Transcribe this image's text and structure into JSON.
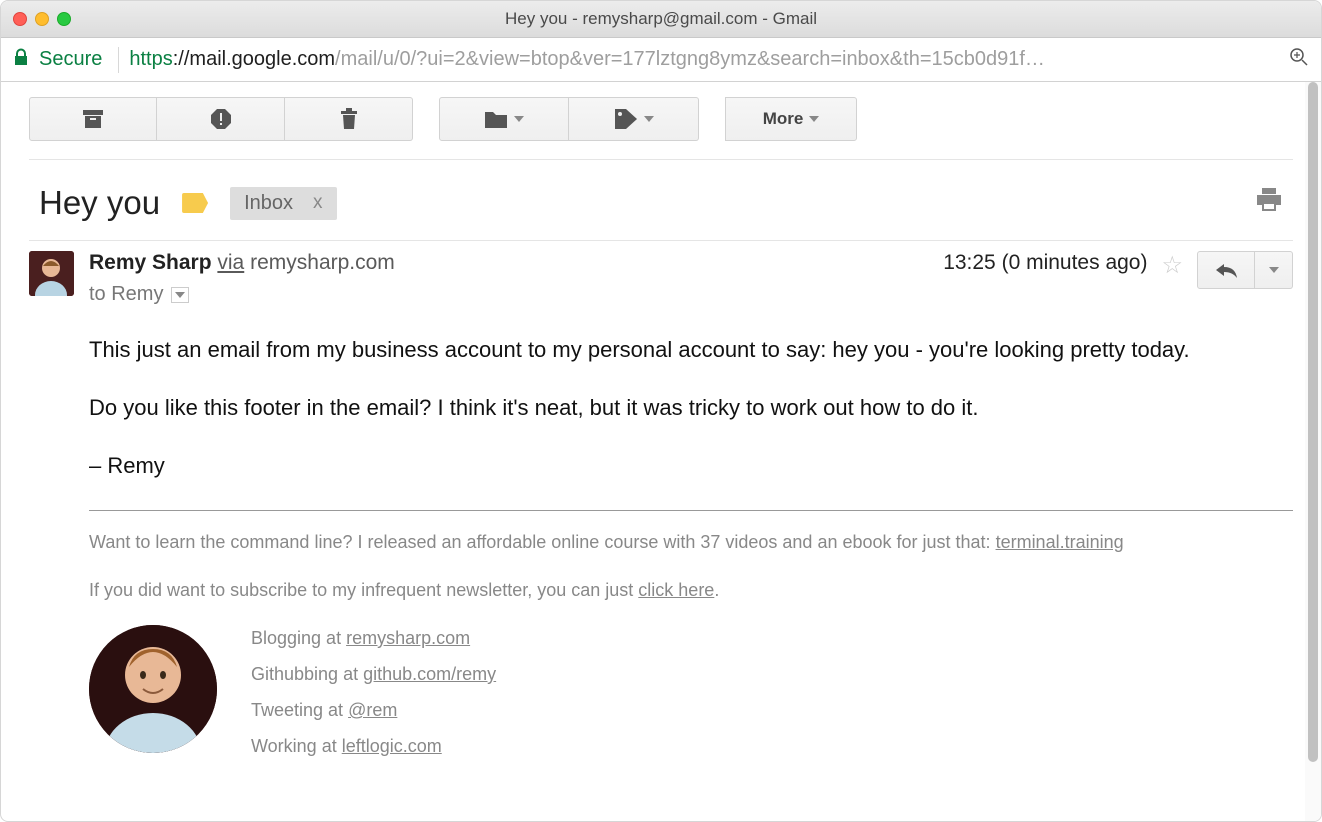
{
  "window": {
    "title": "Hey you - remysharp@gmail.com - Gmail"
  },
  "address": {
    "secure_label": "Secure",
    "scheme": "https",
    "host": "://mail.google.com",
    "path": "/mail/u/0/?ui=2&view=btop&ver=177lztgng8ymz&search=inbox&th=15cb0d91f…"
  },
  "toolbar": {
    "more_label": "More"
  },
  "subject": {
    "text": "Hey you",
    "inbox_label": "Inbox",
    "inbox_close": "x"
  },
  "message": {
    "sender_name": "Remy Sharp",
    "via_label": "via",
    "sender_domain": "remysharp.com",
    "to_label": "to Remy",
    "timestamp": "13:25 (0 minutes ago)"
  },
  "body": {
    "p1": "This just an email from my business account to my personal account to say: hey you - you're looking pretty today.",
    "p2": "Do you like this footer in the email? I think it's neat, but it was tricky to work out how to do it.",
    "p3": "– Remy"
  },
  "footer": {
    "line1_pre": "Want to learn the command line? I released an affordable online course with 37 videos and an ebook for just that: ",
    "line1_link": "terminal.training",
    "line2_pre": "If you did want to subscribe to my infrequent newsletter, you can just ",
    "line2_link": "click here",
    "line2_post": "."
  },
  "signature": {
    "l1_pre": "Blogging at ",
    "l1_link": "remysharp.com",
    "l2_pre": "Githubbing at ",
    "l2_link": "github.com/remy",
    "l3_pre": "Tweeting at ",
    "l3_link": "@rem",
    "l4_pre": "Working at ",
    "l4_link": "leftlogic.com"
  }
}
